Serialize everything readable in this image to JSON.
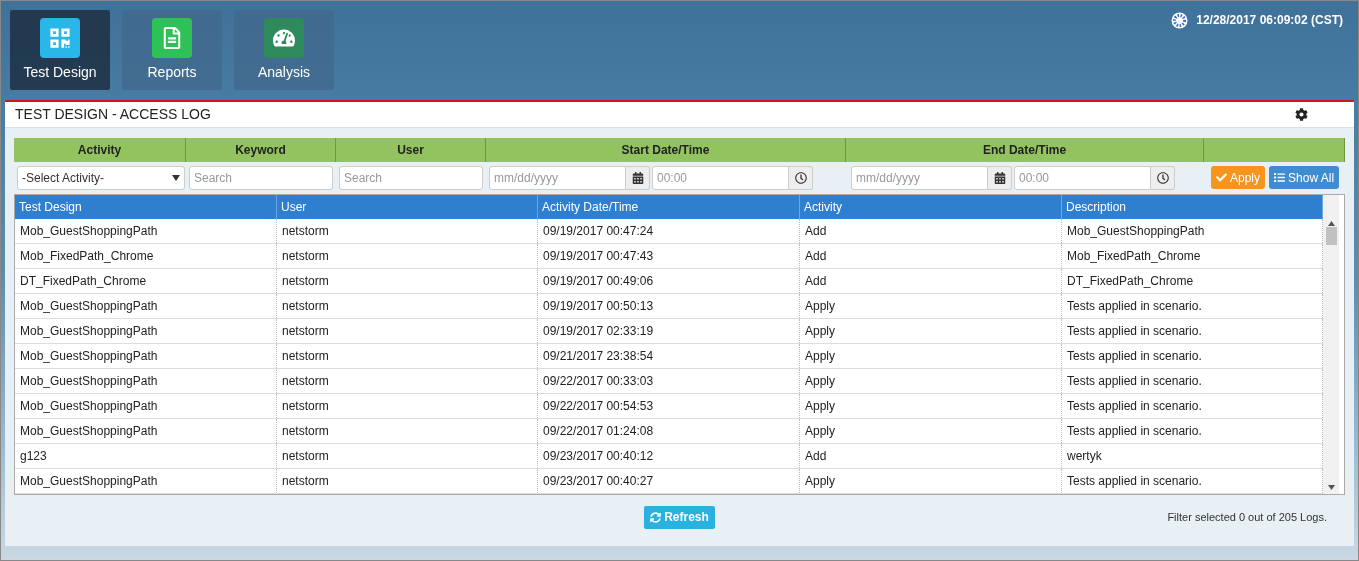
{
  "nav": [
    {
      "label": "Test Design",
      "selected": true,
      "color": "#29b6e8",
      "kind": "qr"
    },
    {
      "label": "Reports",
      "selected": false,
      "color": "#2ec155",
      "kind": "document"
    },
    {
      "label": "Analysis",
      "selected": false,
      "color": "#2e8a5a",
      "kind": "gauge"
    }
  ],
  "clock": "12/28/2017 06:09:02 (CST)",
  "panel": {
    "title": "TEST DESIGN - ACCESS LOG"
  },
  "filters": {
    "headers": [
      "Activity",
      "Keyword",
      "User",
      "Start Date/Time",
      "End Date/Time"
    ],
    "activity_select": "-Select Activity-",
    "keyword": {
      "placeholder": "Search"
    },
    "user": {
      "placeholder": "Search"
    },
    "start_date": {
      "placeholder": "mm/dd/yyyy"
    },
    "start_time": {
      "placeholder": "00:00"
    },
    "end_date": {
      "placeholder": "mm/dd/yyyy"
    },
    "end_time": {
      "placeholder": "00:00"
    },
    "apply": "Apply",
    "show_all": "Show All"
  },
  "table": {
    "columns": [
      "Test Design",
      "User",
      "Activity Date/Time",
      "Activity",
      "Description"
    ],
    "rows": [
      [
        "Mob_GuestShoppingPath",
        "netstorm",
        "09/19/2017 00:47:24",
        "Add",
        "Mob_GuestShoppingPath"
      ],
      [
        "Mob_FixedPath_Chrome",
        "netstorm",
        "09/19/2017 00:47:43",
        "Add",
        "Mob_FixedPath_Chrome"
      ],
      [
        "DT_FixedPath_Chrome",
        "netstorm",
        "09/19/2017 00:49:06",
        "Add",
        "DT_FixedPath_Chrome"
      ],
      [
        "Mob_GuestShoppingPath",
        "netstorm",
        "09/19/2017 00:50:13",
        "Apply",
        "Tests applied in scenario."
      ],
      [
        "Mob_GuestShoppingPath",
        "netstorm",
        "09/19/2017 02:33:19",
        "Apply",
        "Tests applied in scenario."
      ],
      [
        "Mob_GuestShoppingPath",
        "netstorm",
        "09/21/2017 23:38:54",
        "Apply",
        "Tests applied in scenario."
      ],
      [
        "Mob_GuestShoppingPath",
        "netstorm",
        "09/22/2017 00:33:03",
        "Apply",
        "Tests applied in scenario."
      ],
      [
        "Mob_GuestShoppingPath",
        "netstorm",
        "09/22/2017 00:54:53",
        "Apply",
        "Tests applied in scenario."
      ],
      [
        "Mob_GuestShoppingPath",
        "netstorm",
        "09/22/2017 01:24:08",
        "Apply",
        "Tests applied in scenario."
      ],
      [
        "g123",
        "netstorm",
        "09/23/2017 00:40:12",
        "Add",
        "wertyk"
      ],
      [
        "Mob_GuestShoppingPath",
        "netstorm",
        "09/23/2017 00:40:27",
        "Apply",
        "Tests applied in scenario."
      ]
    ]
  },
  "refresh": "Refresh",
  "status": "Filter selected 0 out of 205 Logs."
}
